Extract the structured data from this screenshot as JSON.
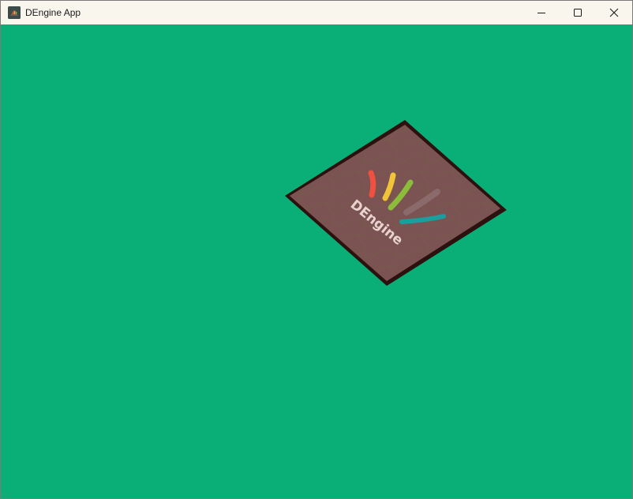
{
  "window": {
    "title": "DEngine App",
    "icons": {
      "app": "app-icon",
      "minimize": "minimize-icon",
      "maximize": "maximize-icon",
      "close": "close-icon"
    }
  },
  "viewport": {
    "background_color": "#0aaf78",
    "quad": {
      "texture_color": "#7a5452",
      "border_color": "#2d110e",
      "logo_text": "DEngine",
      "stroke_colors": [
        "#f05040",
        "#f1c338",
        "#8cbd3a",
        "#8a6a6a",
        "#18a0a0"
      ]
    }
  }
}
